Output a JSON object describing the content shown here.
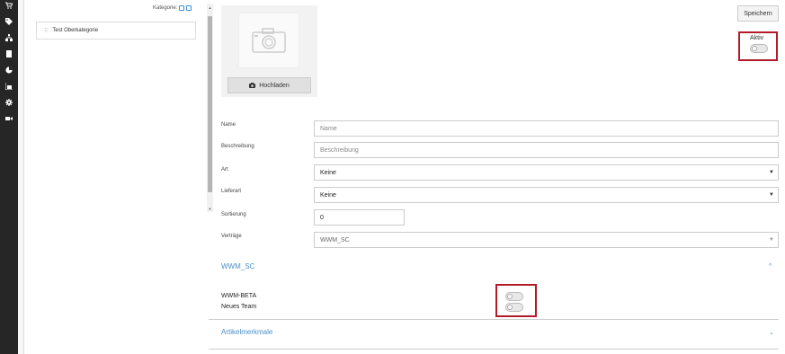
{
  "rail": {
    "icons": [
      "cart-icon",
      "tag-icon",
      "sitemap-icon",
      "document-icon",
      "pie-chart-icon",
      "bar-chart-icon",
      "gear-icon",
      "video-camera-icon"
    ]
  },
  "category_panel": {
    "header_label": "Kategorie:",
    "item_label": "Test Oberkategorie"
  },
  "image_panel": {
    "upload_label": "Hochladen"
  },
  "toolbar": {
    "save_label": "Speichern"
  },
  "status": {
    "aktiv_label": "Aktiv",
    "aktiv_on": false
  },
  "form": {
    "name_label": "Name",
    "name_placeholder": "Name",
    "description_label": "Beschreibung",
    "description_placeholder": "Beschreibung",
    "type_label": "Art",
    "type_value": "Keine",
    "delivery_label": "Lieferart",
    "delivery_value": "Keine",
    "sort_label": "Sortierung",
    "sort_value": "0",
    "contracts_label": "Verträge",
    "contracts_value": "WWM_SC"
  },
  "section_wwm": {
    "title": "WWM_SC",
    "team1_label": "WWM-BETA",
    "team1_on": false,
    "team2_label": "Neues Team",
    "team2_on": false
  },
  "section_features": {
    "title": "Artikelmerkmale"
  }
}
